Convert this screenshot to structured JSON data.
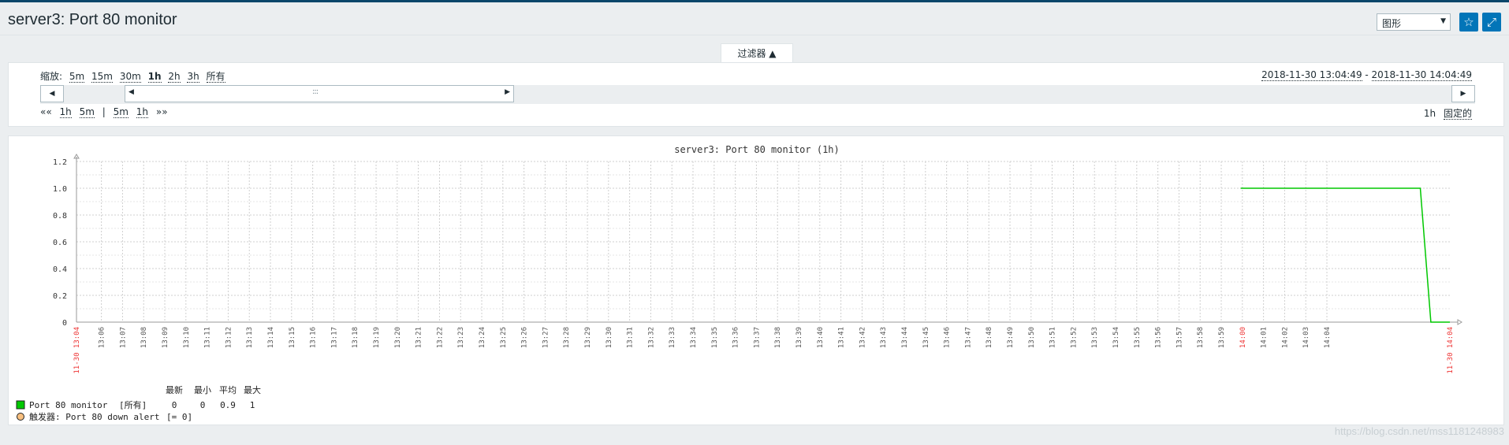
{
  "page": {
    "title": "server3: Port 80 monitor"
  },
  "header": {
    "view_select": "图形",
    "favorite_icon": "star-icon",
    "fullscreen_icon": "expand-icon"
  },
  "filter": {
    "tab_label": "过滤器 ▲",
    "zoom_label": "缩放:",
    "zoom_options": [
      "5m",
      "15m",
      "30m",
      "1h",
      "2h",
      "3h",
      "所有"
    ],
    "zoom_active": "1h",
    "period_start": "2018-11-30 13:04:49",
    "period_sep": " - ",
    "period_end": "2018-11-30 14:04:49",
    "nav_back_label": "««",
    "nav_back": [
      "1h",
      "5m"
    ],
    "nav_sep": "|",
    "nav_fwd": [
      "5m",
      "1h"
    ],
    "nav_fwd_label": "»»",
    "fixed_period": "1h",
    "fixed_label": "固定的"
  },
  "chart_data": {
    "type": "line",
    "title": "server3: Port 80 monitor (1h)",
    "ylim": [
      0,
      1.2
    ],
    "y_ticks": [
      "0",
      "0.2",
      "0.4",
      "0.6",
      "0.8",
      "1.0",
      "1.2"
    ],
    "x_start_label": "11-30 13:04",
    "x_end_label": "11-30 14:04",
    "x_ticks": [
      "13:06",
      "13:07",
      "13:08",
      "13:09",
      "13:10",
      "13:11",
      "13:12",
      "13:13",
      "13:14",
      "13:15",
      "13:16",
      "13:17",
      "13:18",
      "13:19",
      "13:20",
      "13:21",
      "13:22",
      "13:23",
      "13:24",
      "13:25",
      "13:26",
      "13:27",
      "13:28",
      "13:29",
      "13:30",
      "13:31",
      "13:32",
      "13:33",
      "13:34",
      "13:35",
      "13:36",
      "13:37",
      "13:38",
      "13:39",
      "13:40",
      "13:41",
      "13:42",
      "13:43",
      "13:44",
      "13:45",
      "13:46",
      "13:47",
      "13:48",
      "13:49",
      "13:50",
      "13:51",
      "13:52",
      "13:53",
      "13:54",
      "13:55",
      "13:56",
      "13:57",
      "13:58",
      "13:59",
      "14:00",
      "14:01",
      "14:02",
      "14:03",
      "14:04"
    ],
    "highlight_tick": "14:00",
    "series": [
      {
        "name": "Port 80 monitor",
        "color": "#00c800",
        "x": [
          55.1,
          63.6,
          64.1,
          65.0
        ],
        "y": [
          1,
          1,
          0,
          0
        ]
      }
    ],
    "grid": true,
    "legend": {
      "headers": [
        "最新",
        "最小",
        "平均",
        "最大"
      ],
      "items": [
        {
          "name": "Port 80 monitor",
          "scope": "[所有]",
          "values": [
            "0",
            "0",
            "0.9",
            "1"
          ],
          "color": "#00c800"
        },
        {
          "name": "触发器: Port 80 down alert",
          "scope": "[= 0]",
          "values": [],
          "color": "#f8c080"
        }
      ]
    }
  },
  "watermark": "https://blog.csdn.net/mss1181248983"
}
